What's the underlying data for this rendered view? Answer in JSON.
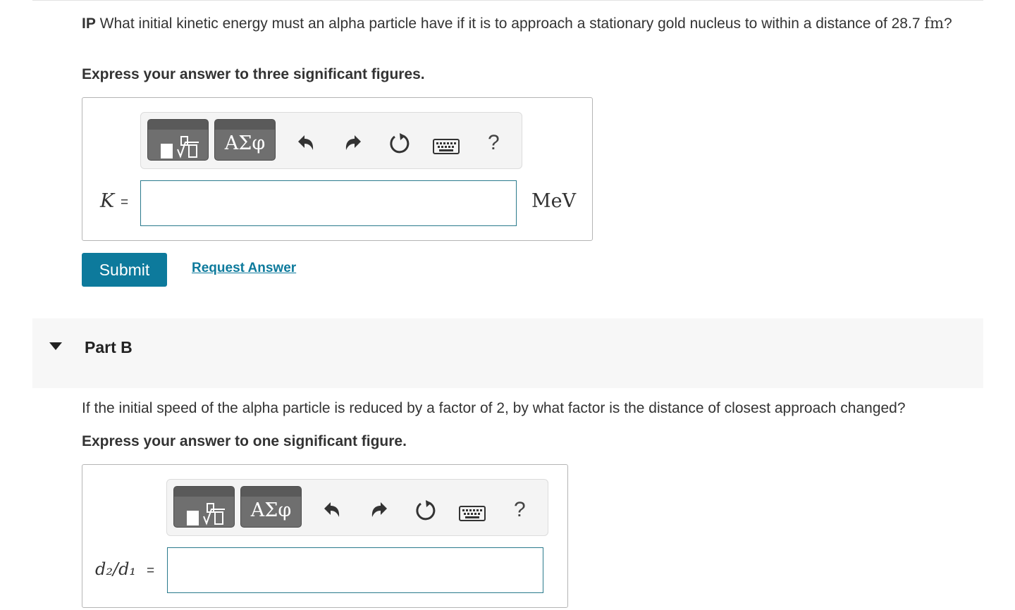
{
  "partA": {
    "question_bold": "IP",
    "question_text": " What initial kinetic energy must an alpha particle have if it is to approach a stationary gold nucleus to within a distance of ",
    "question_value": "28.7",
    "question_unit": "fm",
    "question_end": "?",
    "instruction": "Express your answer to three significant figures.",
    "toolbar": {
      "greek_label": "ΑΣφ",
      "help_label": "?",
      "icons": [
        "templates-icon",
        "greek-symbols-icon",
        "undo-icon",
        "redo-icon",
        "reset-icon",
        "keyboard-icon",
        "help-icon"
      ]
    },
    "variable_label": "K",
    "equals": "=",
    "input_value": "",
    "unit": "MeV",
    "submit_label": "Submit",
    "request_answer_label": "Request Answer"
  },
  "partB": {
    "title": "Part B",
    "question": "If the initial speed of the alpha particle is reduced by a factor of 2, by what factor is the distance of closest approach changed?",
    "instruction": "Express your answer to one significant figure.",
    "toolbar": {
      "greek_label": "ΑΣφ",
      "help_label": "?"
    },
    "variable_label": "d₂/d₁",
    "equals": "=",
    "input_value": ""
  },
  "colors": {
    "accent": "#0d7a9c",
    "input_border": "#2a7a8c",
    "toolbar_button": "#6f6f6f",
    "part_header_bg": "#f7f7f7"
  }
}
